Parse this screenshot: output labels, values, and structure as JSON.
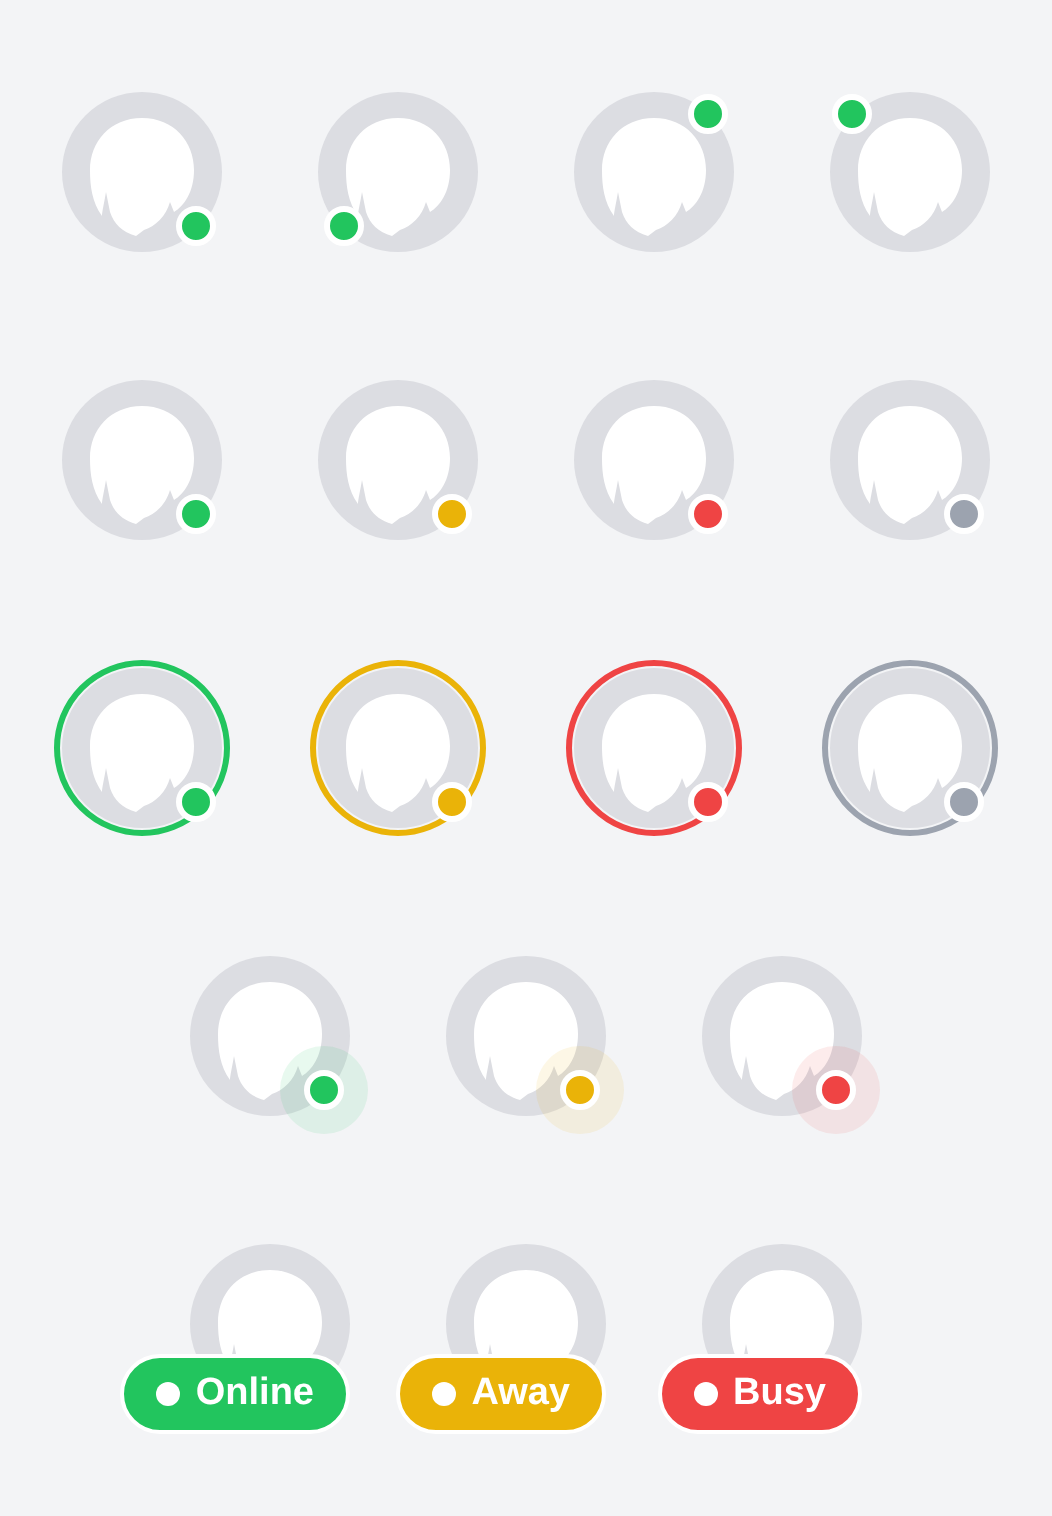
{
  "rows": [
    {
      "kind": "dot",
      "avatars": [
        {
          "color": "#22c55e",
          "kind": "bottomright"
        },
        {
          "color": "#22c55e",
          "kind": "bottomleft"
        },
        {
          "color": "#22c55e",
          "kind": "topright"
        },
        {
          "color": "#22c55e",
          "kind": "topleft"
        }
      ]
    },
    {
      "kind": "dot",
      "avatars": [
        {
          "color": "#22c55e"
        },
        {
          "color": "#eab308"
        },
        {
          "color": "#ef4444"
        },
        {
          "color": "#9ca3af"
        }
      ]
    },
    {
      "kind": "ring",
      "avatars": [
        {
          "color": "#22c55e"
        },
        {
          "color": "#eab308"
        },
        {
          "color": "#ef4444"
        },
        {
          "color": "#9ca3af"
        }
      ]
    },
    {
      "kind": "pulse",
      "avatars": [
        {
          "color": "#22c55e"
        },
        {
          "color": "#eab308"
        },
        {
          "color": "#ef4444"
        }
      ]
    },
    {
      "kind": "badge",
      "avatars": [
        {
          "color": "#22c55e",
          "label": "Online"
        },
        {
          "color": "#eab308",
          "label": "Away"
        },
        {
          "color": "#ef4444",
          "label": "Busy"
        }
      ]
    }
  ]
}
